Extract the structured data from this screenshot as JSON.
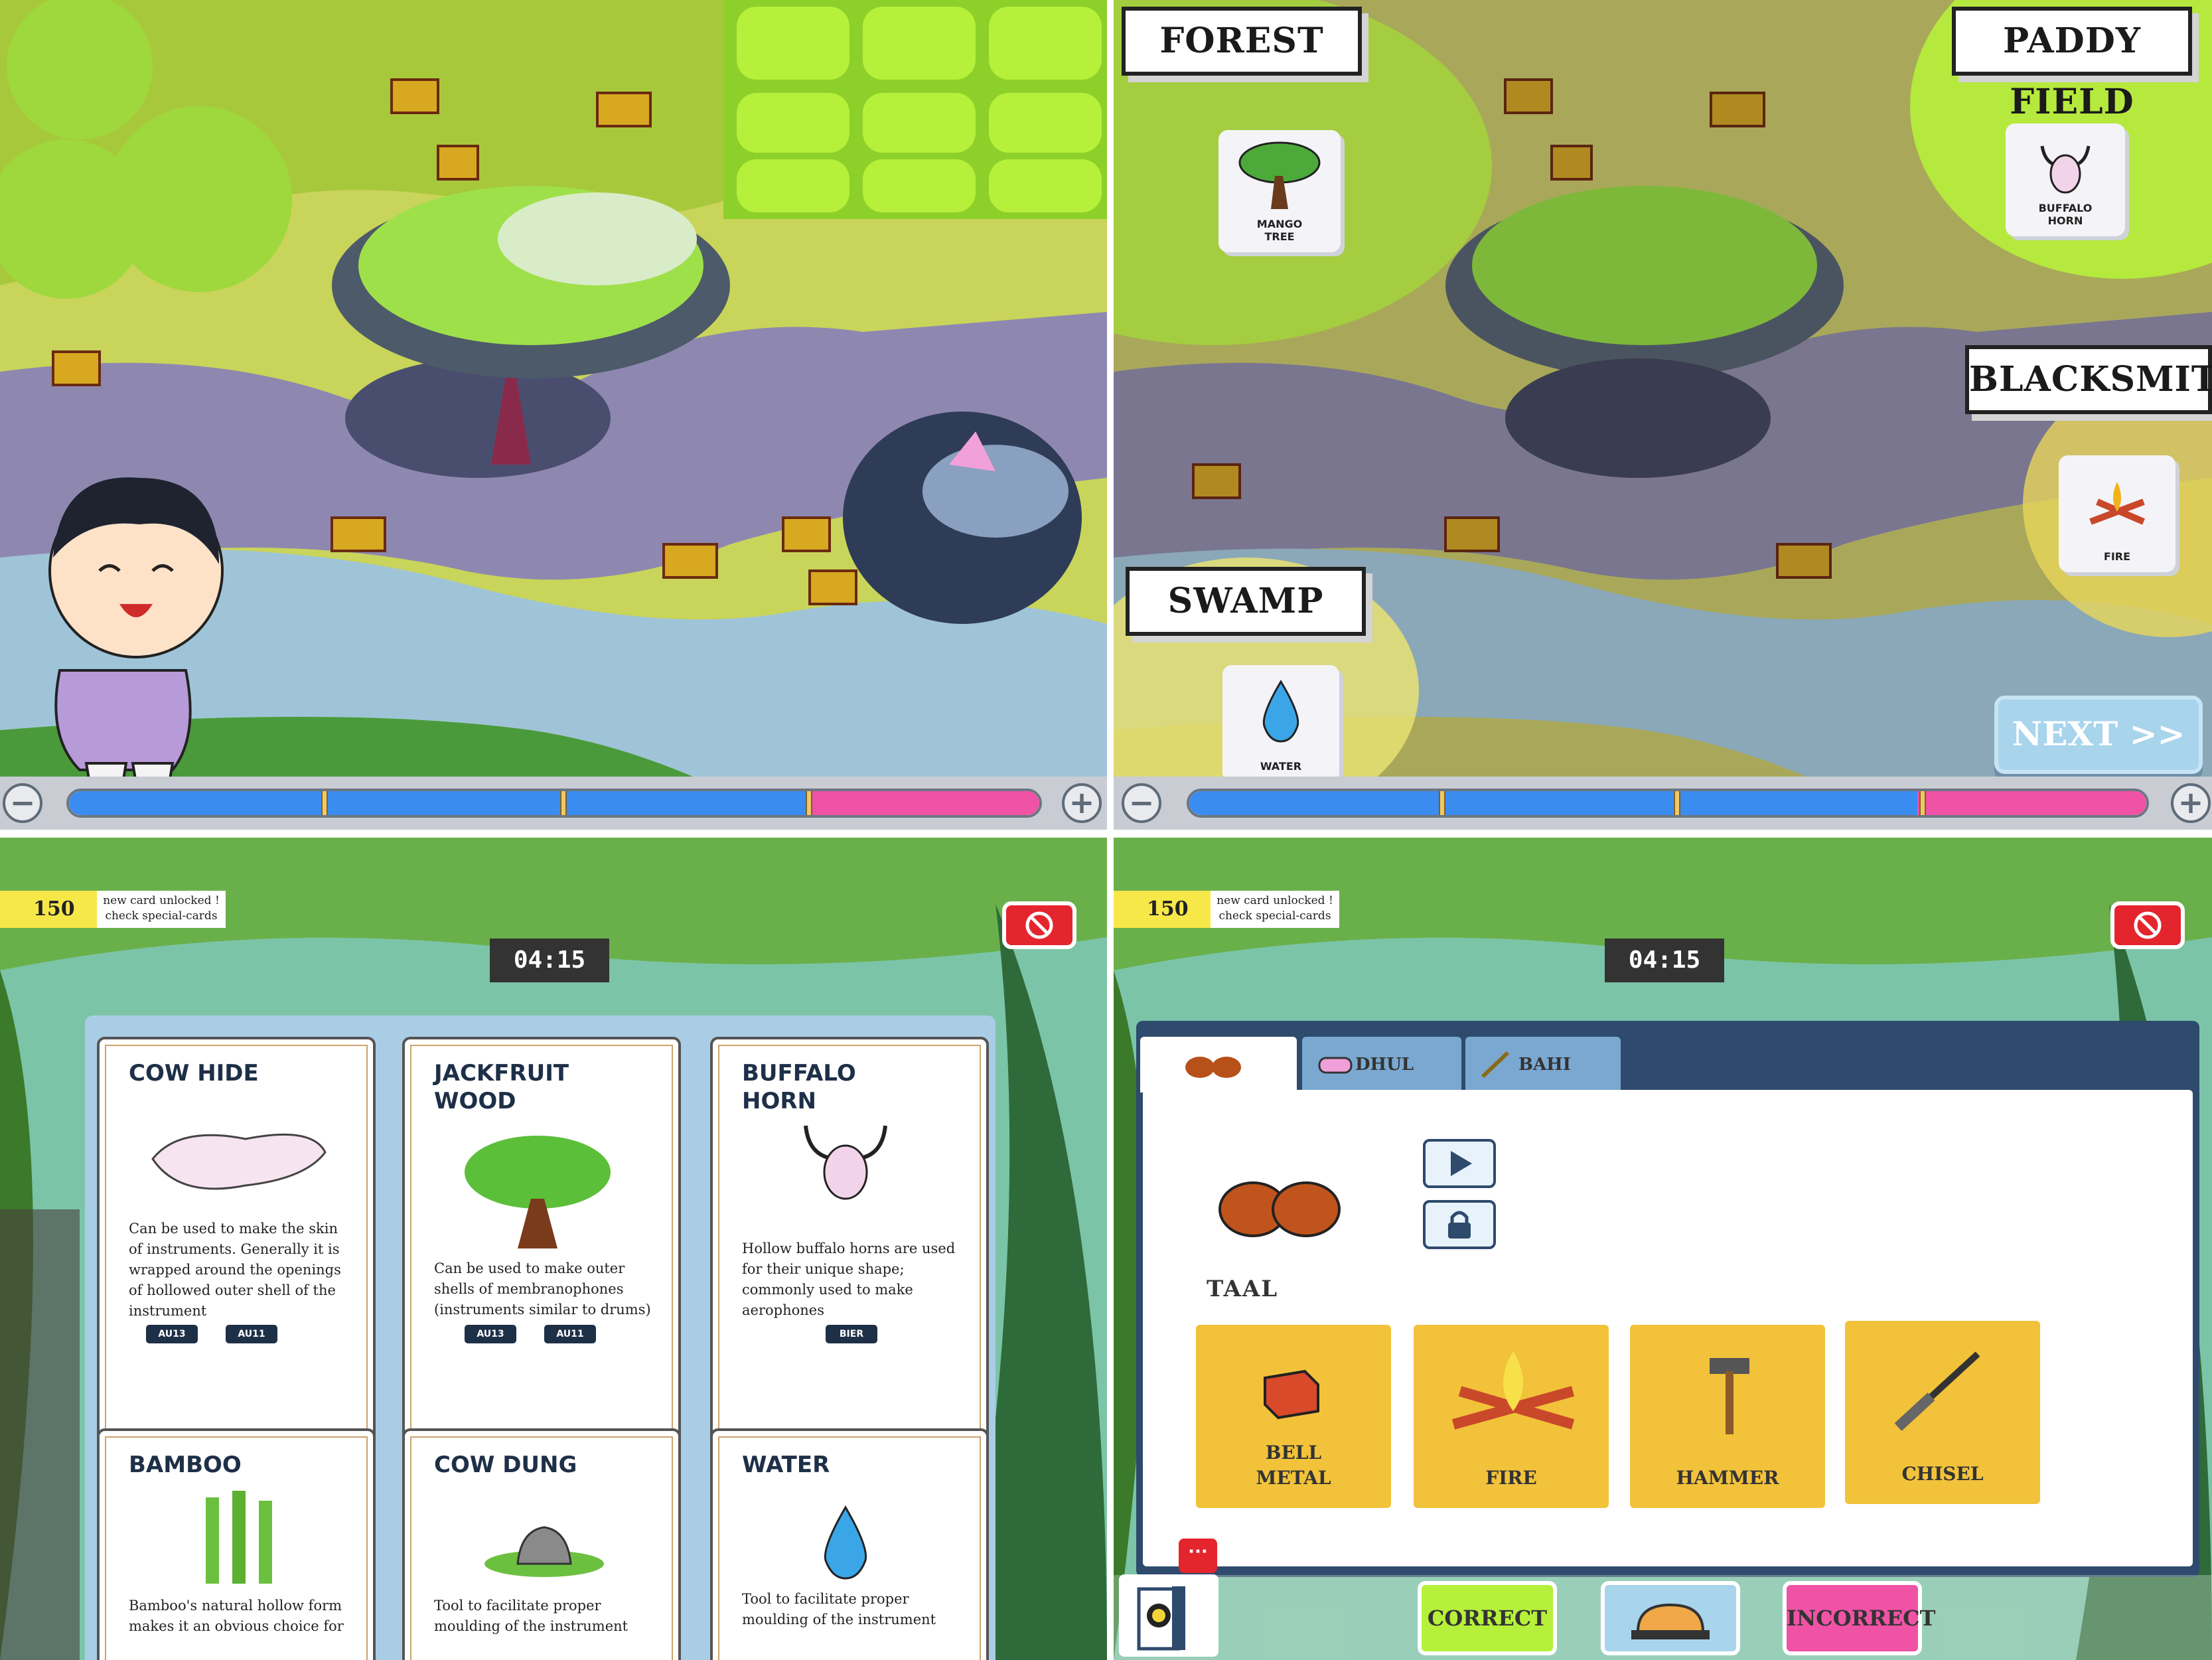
{
  "map_labels": {
    "forest": "FOREST",
    "paddy": "PADDY FIELD",
    "blacksmith": "BLACKSMITH",
    "swamp": "SWAMP"
  },
  "map_cards": {
    "mango": [
      "MANGO",
      "TREE"
    ],
    "buffalo": [
      "BUFFALO",
      "HORN"
    ],
    "fire": "FIRE",
    "water": "WATER"
  },
  "next_label": "NEXT >>",
  "zoom": {
    "minus": "−",
    "plus": "+",
    "level": 0.74
  },
  "hud": {
    "score": "150",
    "notice_line1": "new card unlocked !",
    "notice_line2": "check special-cards",
    "timer": "04:15"
  },
  "cards": [
    {
      "title": [
        "COW HIDE"
      ],
      "desc": "Can be used to make the skin of instruments. Generally it is wrapped around the openings of hollowed outer shell of the instrument",
      "tags": [
        "AU13",
        "AU11"
      ]
    },
    {
      "title": [
        "JACKFRUIT",
        "WOOD"
      ],
      "desc": "Can be used to make outer shells of membranophones (instruments similar to drums)",
      "tags": [
        "AU13",
        "AU11"
      ]
    },
    {
      "title": [
        "BUFFALO",
        "HORN"
      ],
      "desc": "Hollow buffalo horns are used for their unique shape; commonly used to make aerophones",
      "tags": [
        "BIER"
      ]
    },
    {
      "title": [
        "BAMBOO"
      ],
      "desc": "Bamboo's natural hollow form makes it an obvious choice for",
      "tags": []
    },
    {
      "title": [
        "COW DUNG"
      ],
      "desc": "Tool to facilitate proper moulding of the instrument",
      "tags": []
    },
    {
      "title": [
        "WATER"
      ],
      "desc": "Tool to facilitate proper moulding of the instrument",
      "tags": []
    }
  ],
  "tabs": [
    "",
    "DHUL",
    "BAHI"
  ],
  "instrument_name": "TAAL",
  "materials": [
    [
      "BELL",
      "METAL"
    ],
    [
      "FIRE"
    ],
    [
      "HAMMER"
    ],
    [
      "CHISEL"
    ]
  ],
  "actions": {
    "correct": "CORRECT",
    "incorrect": "INCORRECT",
    "chat": "···"
  },
  "colors": {
    "paddy": "#b6f03a",
    "road": "#c8c4d8",
    "accent_red": "#e4252e",
    "card_navy": "#1e2f48"
  }
}
